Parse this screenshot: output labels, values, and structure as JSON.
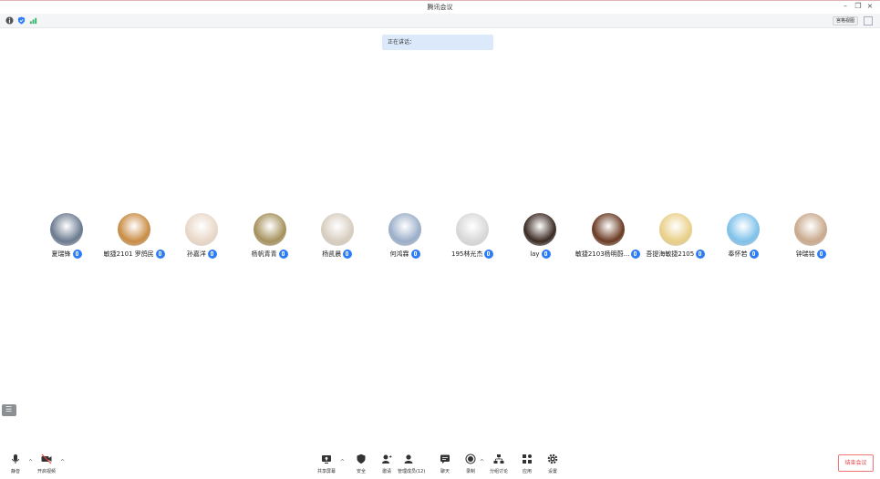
{
  "window": {
    "title": "腾讯会议",
    "controls": [
      "minimize",
      "restore",
      "close"
    ]
  },
  "top_toolbar": {
    "icons": [
      "info-icon",
      "shield-icon",
      "signal-icon"
    ],
    "layout_label": "宫格视图",
    "fullscreen_icon": "fullscreen-icon"
  },
  "toast": {
    "text": "正在讲话："
  },
  "participants": [
    {
      "name": "夏瑞锋",
      "avatar_color": "#6b7a90"
    },
    {
      "name": "敏捷2101 罗鸽民",
      "avatar_color": "#c98c44"
    },
    {
      "name": "孙嘉洋",
      "avatar_color": "#e9d7c7"
    },
    {
      "name": "杨帆青青",
      "avatar_color": "#a6915c"
    },
    {
      "name": "杨凯晨",
      "avatar_color": "#d7cdbf"
    },
    {
      "name": "何鸿霖",
      "avatar_color": "#9aaec9"
    },
    {
      "name": "195林光杰",
      "avatar_color": "#d8d8d8"
    },
    {
      "name": "lay",
      "avatar_color": "#3a2a22"
    },
    {
      "name": "敏捷2103杨明蔚...",
      "avatar_color": "#6a3a22"
    },
    {
      "name": "吾提海敏捷2105",
      "avatar_color": "#e9cf86"
    },
    {
      "name": "奉怀若",
      "avatar_color": "#7ec1ea"
    },
    {
      "name": "钟瑞铭",
      "avatar_color": "#c9a98c"
    }
  ],
  "bottom_left": [
    {
      "label": "静音",
      "icon": "microphone-icon"
    },
    {
      "label": "开启视频",
      "icon": "video-off-icon"
    }
  ],
  "bottom_center": [
    {
      "label": "共享屏幕",
      "icon": "share-screen-icon"
    },
    {
      "label": "安全",
      "icon": "shield-icon"
    },
    {
      "label": "邀请",
      "icon": "invite-icon"
    },
    {
      "label": "管理成员(12)",
      "icon": "members-icon"
    },
    {
      "label": "聊天",
      "icon": "chat-icon"
    },
    {
      "label": "录制",
      "icon": "record-icon"
    },
    {
      "label": "分组讨论",
      "icon": "breakout-icon"
    },
    {
      "label": "应用",
      "icon": "apps-icon"
    },
    {
      "label": "设置",
      "icon": "settings-icon"
    }
  ],
  "end_meeting": {
    "label": "结束会议"
  },
  "colors": {
    "accent": "#2e7cf6",
    "danger": "#e54545",
    "toast_bg": "#dbe9fb"
  }
}
